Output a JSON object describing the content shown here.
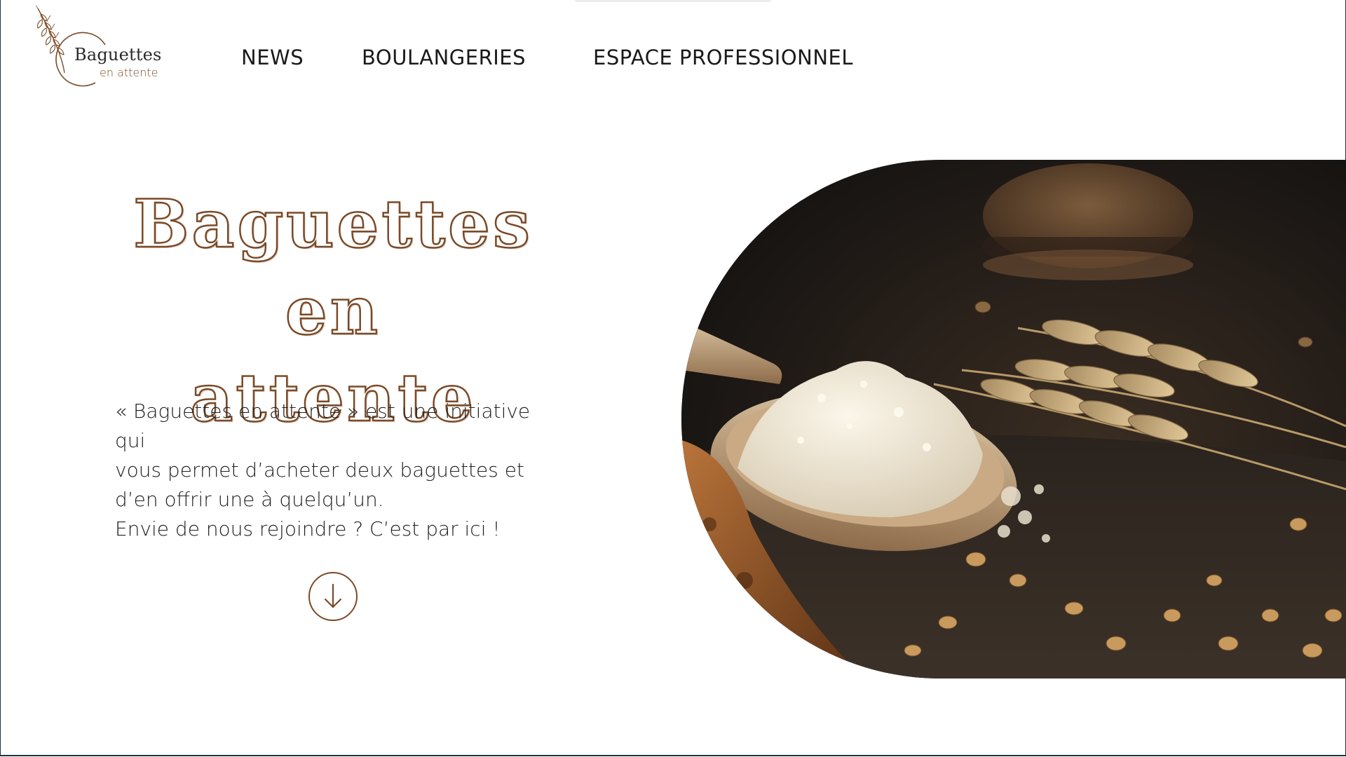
{
  "logo": {
    "main": "Baguettes",
    "sub": "en attente",
    "icon": "wheat-icon"
  },
  "nav": {
    "items": [
      {
        "label": "NEWS"
      },
      {
        "label": "BOULANGERIES"
      },
      {
        "label": "ESPACE PROFESSIONNEL"
      }
    ]
  },
  "hero": {
    "title_line1": "Baguettes en",
    "title_line2": "attente",
    "intro_line1": "« Baguettes en attente » est une initiative qui",
    "intro_line2": "vous permet d’acheter deux baguettes et",
    "intro_line3": "d’en offrir une à quelqu’un.",
    "cta": "Envie de nous rejoindre ? C’est par ici !",
    "scroll_icon": "arrow-down-icon",
    "image": "flour-spoon-wheat-photo"
  },
  "colors": {
    "brand_brown": "#7b4a27",
    "text": "#1f1f1f",
    "frame": "#1f3140"
  }
}
